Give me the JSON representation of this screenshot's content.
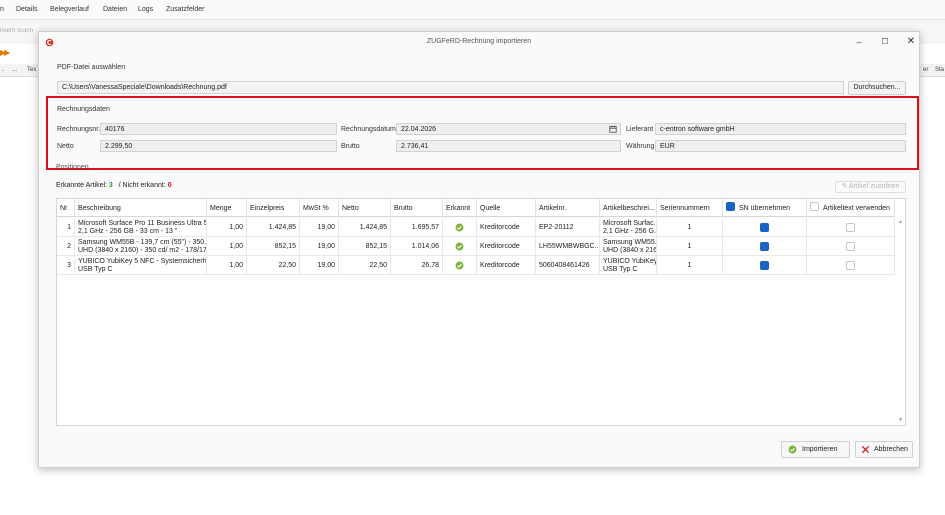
{
  "background": {
    "tabs": [
      "n",
      "Details",
      "Belegverlauf",
      "Dateien",
      "Logs",
      "Zusatzfelder"
    ],
    "scan_placeholder": "nnern scann",
    "grid_headers_left": [
      ".",
      "...",
      "Tex"
    ],
    "grid_headers_right": [
      "er",
      "Sta"
    ]
  },
  "dialog": {
    "title": "ZUGFeRD-Rechnung importieren",
    "pdf_section_label": "PDF-Datei auswählen",
    "pdf_path": "C:\\Users\\VanessaSpeciale\\Downloads\\Rechnung.pdf",
    "browse_label": "Durchsuchen...",
    "invoice_section_label": "Rechnungsdaten",
    "fields": {
      "rechnungsnr_label": "Rechnungsnr.",
      "rechnungsnr_value": "40176",
      "datum_label": "Rechnungsdatum",
      "datum_value": "22.04.2026",
      "lieferant_label": "Lieferant",
      "lieferant_value": "c-entron software gmbH",
      "netto_label": "Netto",
      "netto_value": "2.299,50",
      "brutto_label": "Brutto",
      "brutto_value": "2.736,41",
      "waehrung_label": "Währung",
      "waehrung_value": "EUR"
    },
    "positions_label": "Positionen",
    "recognized_label": "Erkannte Artikel:",
    "recognized_count": "3",
    "unrecognized_label": "/ Nicht erkannt:",
    "unrecognized_count": "0",
    "assign_button": "Artikel zuordnen",
    "columns": [
      "Nr.",
      "Beschreibung",
      "Menge",
      "Einzelpreis",
      "MwSt %",
      "Netto",
      "Brutto",
      "Erkannt",
      "Quelle",
      "Artikelnr.",
      "Artikelbeschrei...",
      "Seriennummern",
      "SN übernehmen",
      "Artikeltext verwenden"
    ],
    "rows": [
      {
        "nr": "1",
        "beschreibung_1": "Microsoft Surface Pro 11 Business Ultra 5...",
        "beschreibung_2": "2,1 GHz - 256 GB - 33 cm - 13 \"",
        "menge": "1,00",
        "einzelpreis": "1.424,85",
        "mwst": "19,00",
        "netto": "1.424,85",
        "brutto": "1.695,57",
        "quelle": "Kreditorcode",
        "artikelnr": "EP2-20112",
        "artikelbeschr_1": "Microsoft Surfac...",
        "artikelbeschr_2": "2,1 GHz - 256 G...",
        "seriennummern": "1",
        "sn_uebernehmen": true,
        "artikeltext": false
      },
      {
        "nr": "2",
        "beschreibung_1": "Samsung WM55B - 139,7 cm (55\") - 350...",
        "beschreibung_2": "UHD (3840 x 2160) - 350 cd/ m2 - 178/17...",
        "menge": "1,00",
        "einzelpreis": "852,15",
        "mwst": "19,00",
        "netto": "852,15",
        "brutto": "1.014,06",
        "quelle": "Kreditorcode",
        "artikelnr": "LH55WMBWBGC...",
        "artikelbeschr_1": "Samsung WM55...",
        "artikelbeschr_2": "UHD (3840 x 216...",
        "seriennummern": "1",
        "sn_uebernehmen": true,
        "artikeltext": false
      },
      {
        "nr": "3",
        "beschreibung_1": "YUBICO YubiKey 5 NFC - Systemsicherhei...",
        "beschreibung_2": "USB Typ C",
        "menge": "1,00",
        "einzelpreis": "22,50",
        "mwst": "19,00",
        "netto": "22,50",
        "brutto": "26,78",
        "quelle": "Kreditorcode",
        "artikelnr": "5060408461426",
        "artikelbeschr_1": "YUBICO YubiKey...",
        "artikelbeschr_2": "USB Typ C",
        "seriennummern": "1",
        "sn_uebernehmen": true,
        "artikeltext": false
      }
    ],
    "import_button": "Importieren",
    "cancel_button": "Abbrechen"
  },
  "colors": {
    "highlight": "#d9101c",
    "brand_logo": "#e2231a",
    "checkbox_on": "#1a63c6",
    "ok_green": "#7fb23a",
    "recognized_green": "#2e8b2e",
    "unrecognized_red": "#d9101c"
  },
  "icons": {
    "app": "centron-logo-icon",
    "calendar": "calendar-icon",
    "recognized": "check-circle-icon",
    "import": "check-circle-icon",
    "cancel": "close-x-icon"
  }
}
